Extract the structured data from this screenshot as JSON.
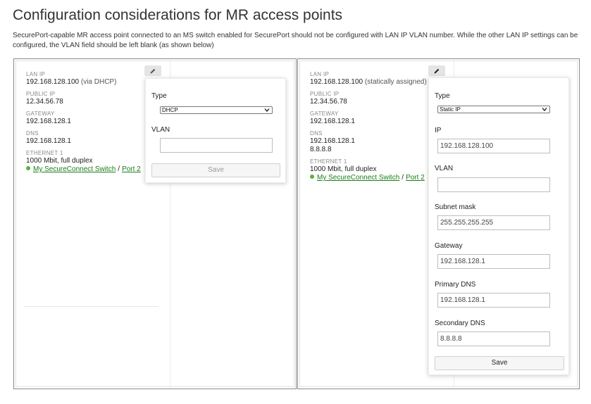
{
  "page": {
    "title": "Configuration considerations for MR access points",
    "description": "SecurePort-capable MR access point connected to an MS switch enabled for SecurePort should not be configured with LAN IP VLAN number. While the other LAN IP settings can be configured, the VLAN field should be left blank (as shown below)"
  },
  "left_panel": {
    "lan_ip_label": "LAN IP",
    "lan_ip": "192.168.128.100",
    "lan_ip_note": "(via DHCP)",
    "public_ip_label": "PUBLIC IP",
    "public_ip": "12.34.56.78",
    "gateway_label": "GATEWAY",
    "gateway": "192.168.128.1",
    "dns_label": "DNS",
    "dns": "192.168.128.1",
    "ethernet_label": "ETHERNET 1",
    "ethernet_speed": "1000 Mbit, full duplex",
    "switch_link": "My SecureConnect Switch",
    "slash": "/",
    "port_link": "Port 2",
    "popover": {
      "type_label": "Type",
      "type_value": "DHCP",
      "vlan_label": "VLAN",
      "vlan_value": "",
      "save_label": "Save"
    }
  },
  "right_panel": {
    "lan_ip_label": "LAN IP",
    "lan_ip": "192.168.128.100",
    "lan_ip_note": "(statically assigned)",
    "public_ip_label": "PUBLIC IP",
    "public_ip": "12.34.56.78",
    "gateway_label": "GATEWAY",
    "gateway": "192.168.128.1",
    "dns_label": "DNS",
    "dns_1": "192.168.128.1",
    "dns_2": "8.8.8.8",
    "ethernet_label": "ETHERNET 1",
    "ethernet_speed": "1000 Mbit, full duplex",
    "switch_link": "My SecureConnect Switch",
    "slash": "/",
    "port_link": "Port 2",
    "popover": {
      "type_label": "Type",
      "type_value": "Static IP",
      "ip_label": "IP",
      "ip_value": "192.168.128.100",
      "vlan_label": "VLAN",
      "vlan_value": "",
      "subnet_label": "Subnet mask",
      "subnet_value": "255.255.255.255",
      "gateway_label": "Gateway",
      "gateway_value": "192.168.128.1",
      "primary_dns_label": "Primary DNS",
      "primary_dns_value": "192.168.128.1",
      "secondary_dns_label": "Secondary DNS",
      "secondary_dns_value": "8.8.8.8",
      "save_label": "Save"
    }
  },
  "icons": {
    "edit": "pencil-icon",
    "dropdown": "chevron-down-icon",
    "status": "status-dot-icon"
  },
  "colors": {
    "link": "#1a7d1a",
    "status_dot": "#5ab043",
    "panel_border": "#8a8a8a"
  }
}
